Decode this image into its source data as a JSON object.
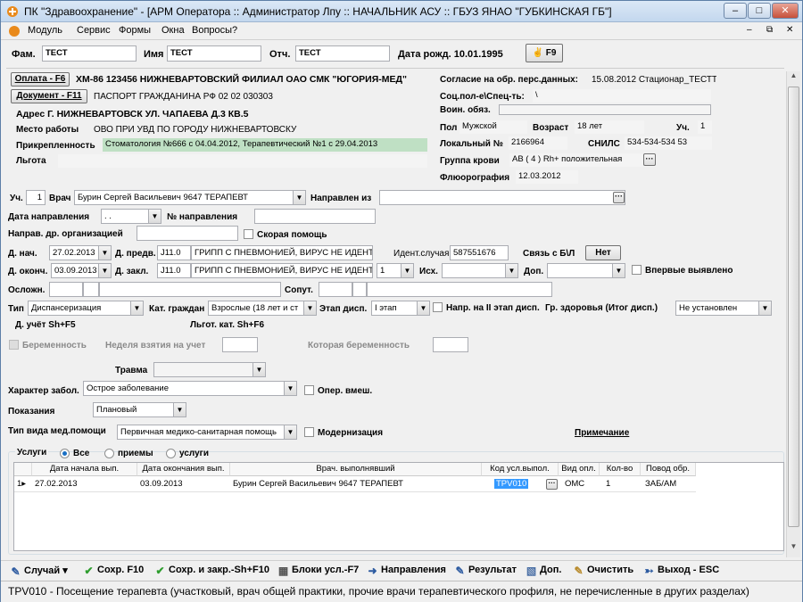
{
  "window": {
    "title": "ПК \"Здравоохранение\" - [АРМ Оператора :: Администратор Лпу  :: НАЧАЛЬНИК АСУ :: ГБУЗ ЯНАО \"ГУБКИНСКАЯ ГБ\"]"
  },
  "menu": [
    "Модуль",
    "Сервис",
    "Формы",
    "Окна",
    "Вопросы?"
  ],
  "patient": {
    "fam_label": "Фам.",
    "fam": "ТЕСТ",
    "im_label": "Имя",
    "im": "ТЕСТ",
    "otch_label": "Отч.",
    "otch": "ТЕСТ",
    "dob": "Дата рожд. 10.01.1995",
    "f9": "F9"
  },
  "left": {
    "oplata_btn": "Оплата - F6",
    "oplata": "ХМ-86 123456 НИЖНЕВАРТОВСКИЙ ФИЛИАЛ ОАО СМК \"ЮГОРИЯ-МЕД\"",
    "doc_btn": "Документ - F11",
    "doc": "ПАСПОРТ ГРАЖДАНИНА РФ 02 02 030303",
    "address": "Адрес  Г. НИЖНЕВАРТОВСК УЛ. ЧАПАЕВА Д.3  КВ.5",
    "work_label": "Место работы",
    "work": "ОВО ПРИ УВД ПО ГОРОДУ НИЖНЕВАРТОВСКУ",
    "attach_label": "Прикрепленность",
    "attach": "Стоматология №666 с 04.04.2012, Терапевтический №1 с 29.04.2013",
    "lgota_label": "Льгота",
    "lgota": ""
  },
  "right": {
    "consent_label": "Согласие на обр. перс.данных:",
    "consent": "15.08.2012 Стационар_ТЕСТТ95",
    "soc_label": "Соц.пол-е\\Спец-ть:",
    "soc": "\\",
    "voin_label": "Воин. обяз.",
    "pol_label": "Пол",
    "pol": "Мужской",
    "age_label": "Возраст",
    "age": "18 лет",
    "uch_label": "Уч.",
    "uch": "1",
    "local_label": "Локальный №",
    "local": "2166964",
    "snils_label": "СНИЛС",
    "snils": "534-534-534 53",
    "blood_label": "Группа крови",
    "blood": "АВ ( 4 ) Rh+ положительная",
    "fluoro_label": "Флюорография",
    "fluoro": "12.03.2012"
  },
  "form": {
    "uch_label": "Уч.",
    "uch": "1",
    "vrach_label": "Врач",
    "vrach": "Бурин Сергей Васильевич 9647 ТЕРАПЕВТ",
    "napr_iz_label": "Направлен из",
    "napr_iz": "",
    "data_napr_label": "Дата направления",
    "data_napr": " .  .",
    "n_napr_label": "№ направления",
    "napr_dr_label": "Направ. др. организацией",
    "skoraya_label": "Скорая помощь",
    "d_nach_label": "Д. нач.",
    "d_nach": "27.02.2013",
    "d_pred_label": "Д. предв.",
    "d_pred_code": "J11.0",
    "d_pred": "ГРИПП С ПНЕВМОНИЕЙ, ВИРУС НЕ ИДЕНТИФИ",
    "ident_label": "Идент.случая",
    "ident": "587551676",
    "svyaz_label": "Связь с Б\\Л",
    "svyaz_btn": "Нет",
    "d_okonch_label": "Д. оконч.",
    "d_okonch": "03.09.2013",
    "d_zakl_label": "Д. закл.",
    "d_zakl_code": "J11.0",
    "d_zakl": "ГРИПП С ПНЕВМОНИЕЙ, ВИРУС НЕ ИДЕНТИФИ",
    "d_zakl_n": "1",
    "isx_label": "Исх.",
    "dop_label": "Доп.",
    "vpervye_label": "Впервые выявлено",
    "oslozh_label": "Осложн.",
    "soput_label": "Сопут.",
    "tip_label": "Тип",
    "tip": "Диспансеризация",
    "kat_label": "Кат. граждан",
    "kat": "Взрослые (18 лет и ст",
    "etap_label": "Этап дисп.",
    "etap": "I этап",
    "napr2_label": "Напр. на II этап дисп.",
    "gr_label": "Гр. здоровья (Итог дисп.)",
    "gr": "Не установлен",
    "d_uchet": "Д. учёт Sh+F5",
    "lgot_kat": "Льгот. кат. Sh+F6",
    "berem_label": "Беременность",
    "nedelya_label": "Неделя взятия на учет",
    "kotoraya_label": "Которая беременность",
    "travma_label": "Травма",
    "harakter_label": "Характер забол.",
    "harakter": "Острое заболевание",
    "oper_label": "Опер. вмеш.",
    "pokaz_label": "Показания",
    "pokaz": "Плановый",
    "tip_med_label": "Тип вида мед.помощи",
    "tip_med": "Первичная медико-санитарная помощь",
    "modern_label": "Модернизация",
    "primech": "Примечание"
  },
  "services": {
    "title": "Услуги",
    "filters": [
      "Все",
      "приемы",
      "услуги"
    ],
    "columns": [
      "Дата начала вып.",
      "Дата окончания вып.",
      "Врач. выполнявший",
      "Код усл.выпол.",
      "Вид опл.",
      "Кол-во",
      "Повод обр."
    ],
    "rows": [
      {
        "n": "1",
        "start": "27.02.2013",
        "end": "03.09.2013",
        "doctor": "Бурин Сергей Васильевич 9647 ТЕРАПЕВТ",
        "code": "TPV010",
        "opl": "ОМС",
        "qty": "1",
        "povod": "ЗАБ/АМ"
      }
    ]
  },
  "toolbar": [
    "Случай",
    "Сохр. F10",
    "Сохр. и закр.-Sh+F10",
    "Блоки усл.-F7",
    "Направления",
    "Результат",
    "Доп.",
    "Очистить",
    "Выход - ESC"
  ],
  "status": "TPV010 - Посещение терапевта (участковый, врач общей практики, прочие врачи терапевтического профиля, не перечисленные в других разделах)"
}
